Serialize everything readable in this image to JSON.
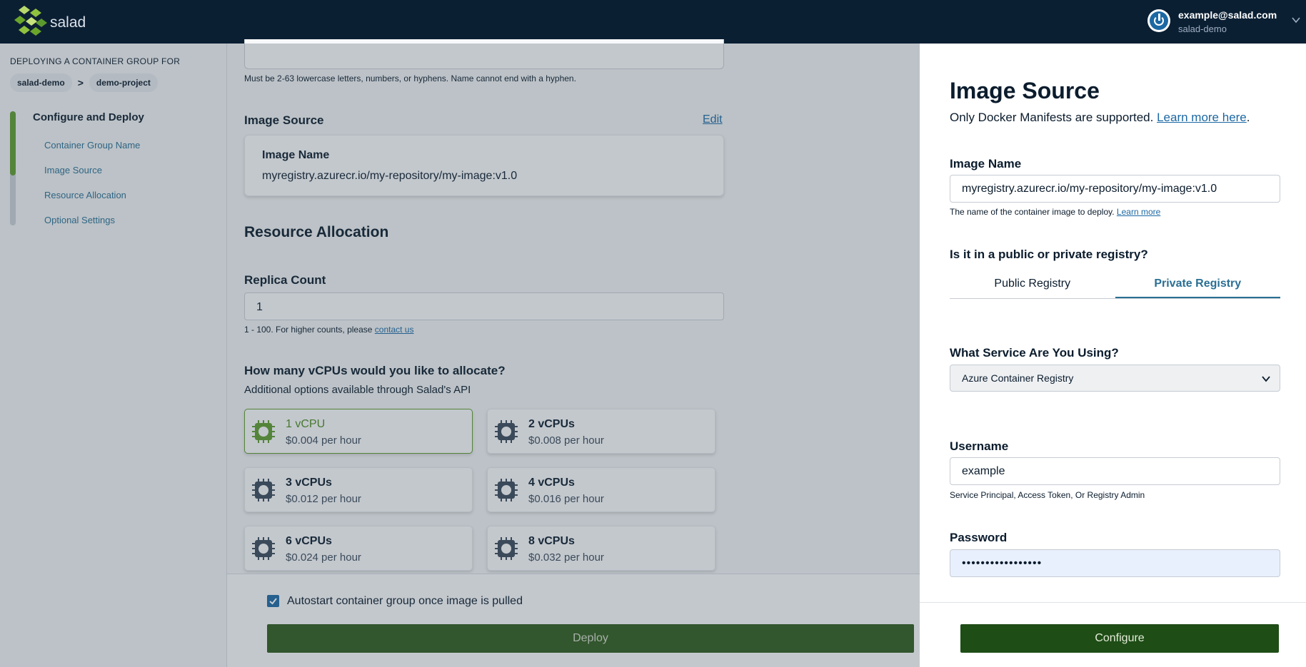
{
  "header": {
    "brand": "salad",
    "user_email": "example@salad.com",
    "user_org": "salad-demo"
  },
  "sidebar": {
    "deploying_for": "DEPLOYING A CONTAINER GROUP FOR",
    "org": "salad-demo",
    "separator": ">",
    "project": "demo-project",
    "section_title": "Configure and Deploy",
    "steps": [
      "Container Group Name",
      "Image Source",
      "Resource Allocation",
      "Optional Settings"
    ]
  },
  "main": {
    "name_hint": "Must be 2-63 lowercase letters, numbers, or hyphens. Name cannot end with a hyphen.",
    "image_source_title": "Image Source",
    "edit": "Edit",
    "image_name_label": "Image Name",
    "image_name_value": "myregistry.azurecr.io/my-repository/my-image:v1.0",
    "resource_title": "Resource Allocation",
    "replica_label": "Replica Count",
    "replica_value": "1",
    "replica_hint": "1 - 100. For higher counts, please ",
    "contact_us": "contact us",
    "cpu_question": "How many vCPUs would you like to allocate?",
    "cpu_sub": "Additional options available through Salad's API",
    "cpus": [
      {
        "name": "1 vCPU",
        "price": "$0.004 per hour"
      },
      {
        "name": "2 vCPUs",
        "price": "$0.008 per hour"
      },
      {
        "name": "3 vCPUs",
        "price": "$0.012 per hour"
      },
      {
        "name": "4 vCPUs",
        "price": "$0.016 per hour"
      },
      {
        "name": "6 vCPUs",
        "price": "$0.024 per hour"
      },
      {
        "name": "8 vCPUs",
        "price": "$0.032 per hour"
      }
    ],
    "autostart": "Autostart container group once image is pulled",
    "deploy": "Deploy"
  },
  "panel": {
    "title": "Image Source",
    "subtitle": "Only Docker Manifests are supported. ",
    "learn_more_here": "Learn more here",
    "period": ".",
    "image_name_label": "Image Name",
    "image_name_value": "myregistry.azurecr.io/my-repository/my-image:v1.0",
    "image_hint": "The name of the container image to deploy. ",
    "learn_more": "Learn more",
    "registry_question": "Is it in a public or private registry?",
    "tab_public": "Public Registry",
    "tab_private": "Private Registry",
    "service_question": "What Service Are You Using?",
    "service_value": "Azure Container Registry",
    "username_label": "Username",
    "username_value": "example",
    "username_hint": "Service Principal, Access Token, Or Registry Admin",
    "password_label": "Password",
    "password_value": "•••••••••••••••••",
    "configure": "Configure"
  }
}
